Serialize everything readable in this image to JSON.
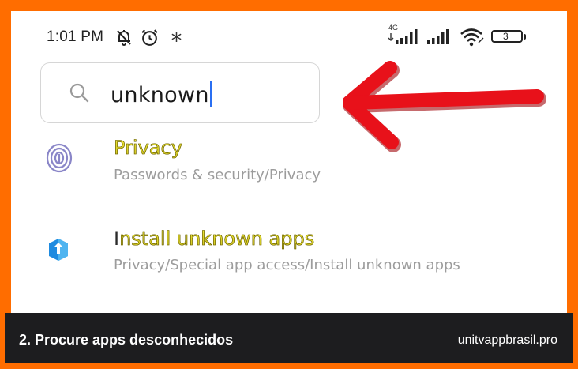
{
  "status_bar": {
    "time": "1:01 PM",
    "network_label": "4G",
    "battery": "3",
    "icons": [
      "muted-bell-icon",
      "alarm-icon",
      "snowflake-icon",
      "signal-icon",
      "signal-icon",
      "wifi-icon",
      "battery-icon"
    ]
  },
  "search": {
    "value": "unknown",
    "icon": "search-icon"
  },
  "annotation": {
    "arrow_color": "#e8111a",
    "icon": "arrow-left-icon"
  },
  "results": [
    {
      "title": "Privacy",
      "subtitle": "Passwords & security/Privacy",
      "icon": "fingerprint-icon"
    },
    {
      "title_prefix": "I",
      "title_highlight": "nstall unknown apps",
      "title": "Install unknown apps",
      "subtitle": "Privacy/Special app access/Install unknown apps",
      "icon": "shield-icon"
    }
  ],
  "caption": {
    "left": "2. Procure apps desconhecidos",
    "right": "unitvappbrasil.pro"
  },
  "colors": {
    "border": "#ff6d00",
    "highlight": "#e8e23a",
    "arrow": "#e8111a",
    "caption_bg": "#1d1d1f",
    "caret": "#2a6ff2"
  }
}
